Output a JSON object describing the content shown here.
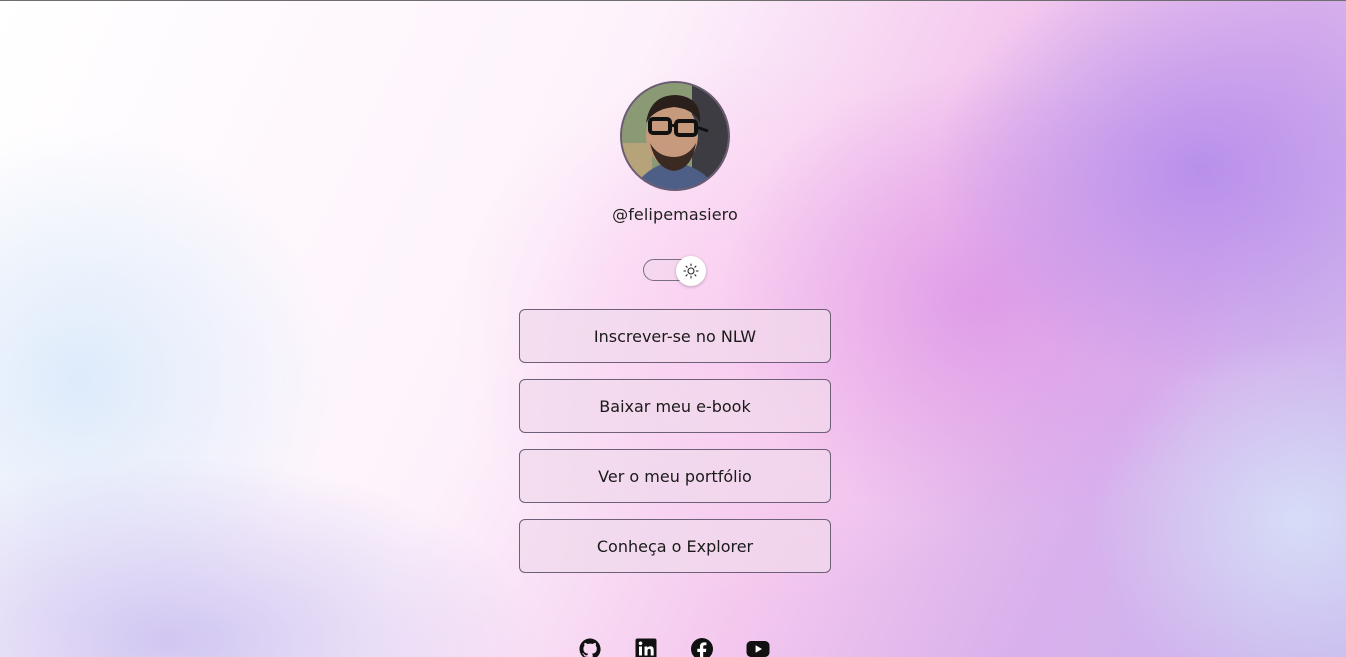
{
  "profile": {
    "username": "@felipemasiero",
    "avatar_icon": "profile-photo"
  },
  "theme_switch": {
    "icon": "sun-icon",
    "state": "light"
  },
  "links": [
    {
      "label": "Inscrever-se no NLW"
    },
    {
      "label": "Baixar meu e-book"
    },
    {
      "label": "Ver o meu portfólio"
    },
    {
      "label": "Conheça o Explorer"
    }
  ],
  "social": [
    {
      "icon": "github-icon"
    },
    {
      "icon": "linkedin-icon"
    },
    {
      "icon": "facebook-icon"
    },
    {
      "icon": "youtube-icon"
    }
  ],
  "colors": {
    "text": "#1a1a1a",
    "button_border": "#6e6078",
    "button_fill": "#f0daec",
    "accent_purple": "#b48ceb",
    "accent_pink": "#f4c8ee"
  }
}
